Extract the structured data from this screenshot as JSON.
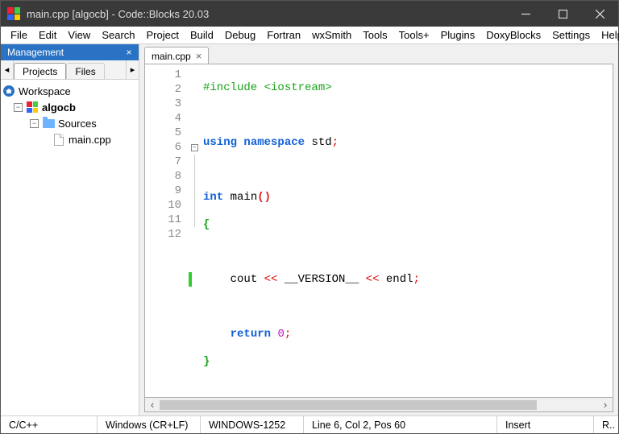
{
  "window": {
    "title": "main.cpp [algocb] - Code::Blocks 20.03"
  },
  "menu": [
    "File",
    "Edit",
    "View",
    "Search",
    "Project",
    "Build",
    "Debug",
    "Fortran",
    "wxSmith",
    "Tools",
    "Tools+",
    "Plugins",
    "DoxyBlocks",
    "Settings",
    "Help"
  ],
  "mgmt": {
    "title": "Management",
    "tabs": {
      "projects": "Projects",
      "files": "Files"
    },
    "tree": {
      "workspace": "Workspace",
      "project": "algocb",
      "sources": "Sources",
      "file": "main.cpp"
    }
  },
  "editor": {
    "tab": "main.cpp",
    "lines": {
      "1": {
        "pp": "#include ",
        "inc": "<iostream>"
      },
      "3": {
        "kw1": "using",
        "kw2": "namespace",
        "id": "std"
      },
      "5": {
        "kw": "int",
        "fn": "main"
      },
      "6": {
        "brace": "{"
      },
      "8": {
        "cout": "cout",
        "op1": "<<",
        "ver": "__VERSION__",
        "op2": "<<",
        "endl": "endl"
      },
      "10": {
        "kw": "return",
        "num": "0"
      },
      "11": {
        "brace": "}"
      }
    },
    "lineNumbers": [
      "1",
      "2",
      "3",
      "4",
      "5",
      "6",
      "7",
      "8",
      "9",
      "10",
      "11",
      "12"
    ]
  },
  "status": {
    "lang": "C/C++",
    "eol": "Windows (CR+LF)",
    "enc": "WINDOWS-1252",
    "pos": "Line 6, Col 2, Pos 60",
    "mode": "Insert",
    "extra": "R.."
  }
}
